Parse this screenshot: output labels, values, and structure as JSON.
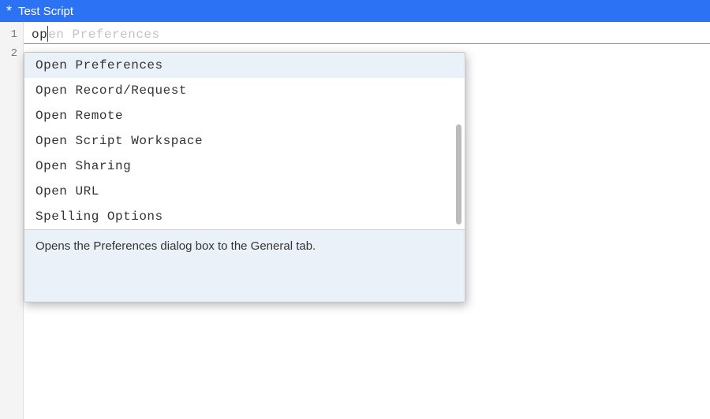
{
  "title_bar": {
    "modified_indicator": "*",
    "title": "Test Script"
  },
  "editor": {
    "lines": [
      {
        "number": "1",
        "typed": "op",
        "ghost": "en Preferences",
        "active": true
      },
      {
        "number": "2",
        "typed": "",
        "ghost": "",
        "active": false
      }
    ]
  },
  "autocomplete": {
    "items": [
      {
        "label": "Open Preferences",
        "selected": true
      },
      {
        "label": "Open Record/Request",
        "selected": false
      },
      {
        "label": "Open Remote",
        "selected": false
      },
      {
        "label": "Open Script Workspace",
        "selected": false
      },
      {
        "label": "Open Sharing",
        "selected": false
      },
      {
        "label": "Open URL",
        "selected": false
      },
      {
        "label": "Spelling Options",
        "selected": false
      }
    ],
    "description": "Opens the Preferences dialog box to the General tab."
  }
}
